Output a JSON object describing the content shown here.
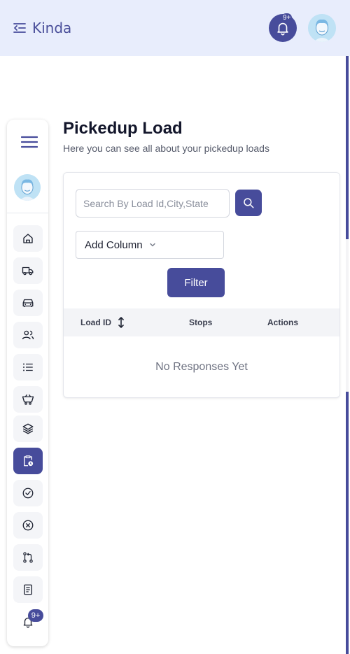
{
  "header": {
    "brand_name": "Kinda",
    "notification_badge": "9+",
    "brand_color": "#474c9b",
    "topbar_color": "#e8edfc"
  },
  "sidebar": {
    "items": [
      {
        "icon": "home-icon"
      },
      {
        "icon": "truck-icon"
      },
      {
        "icon": "car-icon"
      },
      {
        "icon": "users-icon"
      },
      {
        "icon": "list-icon"
      },
      {
        "icon": "cart-icon"
      },
      {
        "icon": "layers-icon"
      },
      {
        "icon": "clipboard-clock-icon",
        "active": true
      },
      {
        "icon": "check-circle-icon"
      },
      {
        "icon": "x-circle-icon"
      },
      {
        "icon": "git-pull-icon"
      },
      {
        "icon": "document-icon"
      },
      {
        "icon": "bell-icon"
      }
    ],
    "notification_badge": "9+"
  },
  "main": {
    "title": "Pickedup Load",
    "subtitle": "Here you can see all about your pickedup loads",
    "search": {
      "placeholder": "Search By Load Id,City,State"
    },
    "add_column_label": "Add Column",
    "filter_label": "Filter",
    "table": {
      "columns": [
        "Load ID",
        "Stops",
        "Actions"
      ],
      "empty_text": "No Responses Yet"
    }
  }
}
